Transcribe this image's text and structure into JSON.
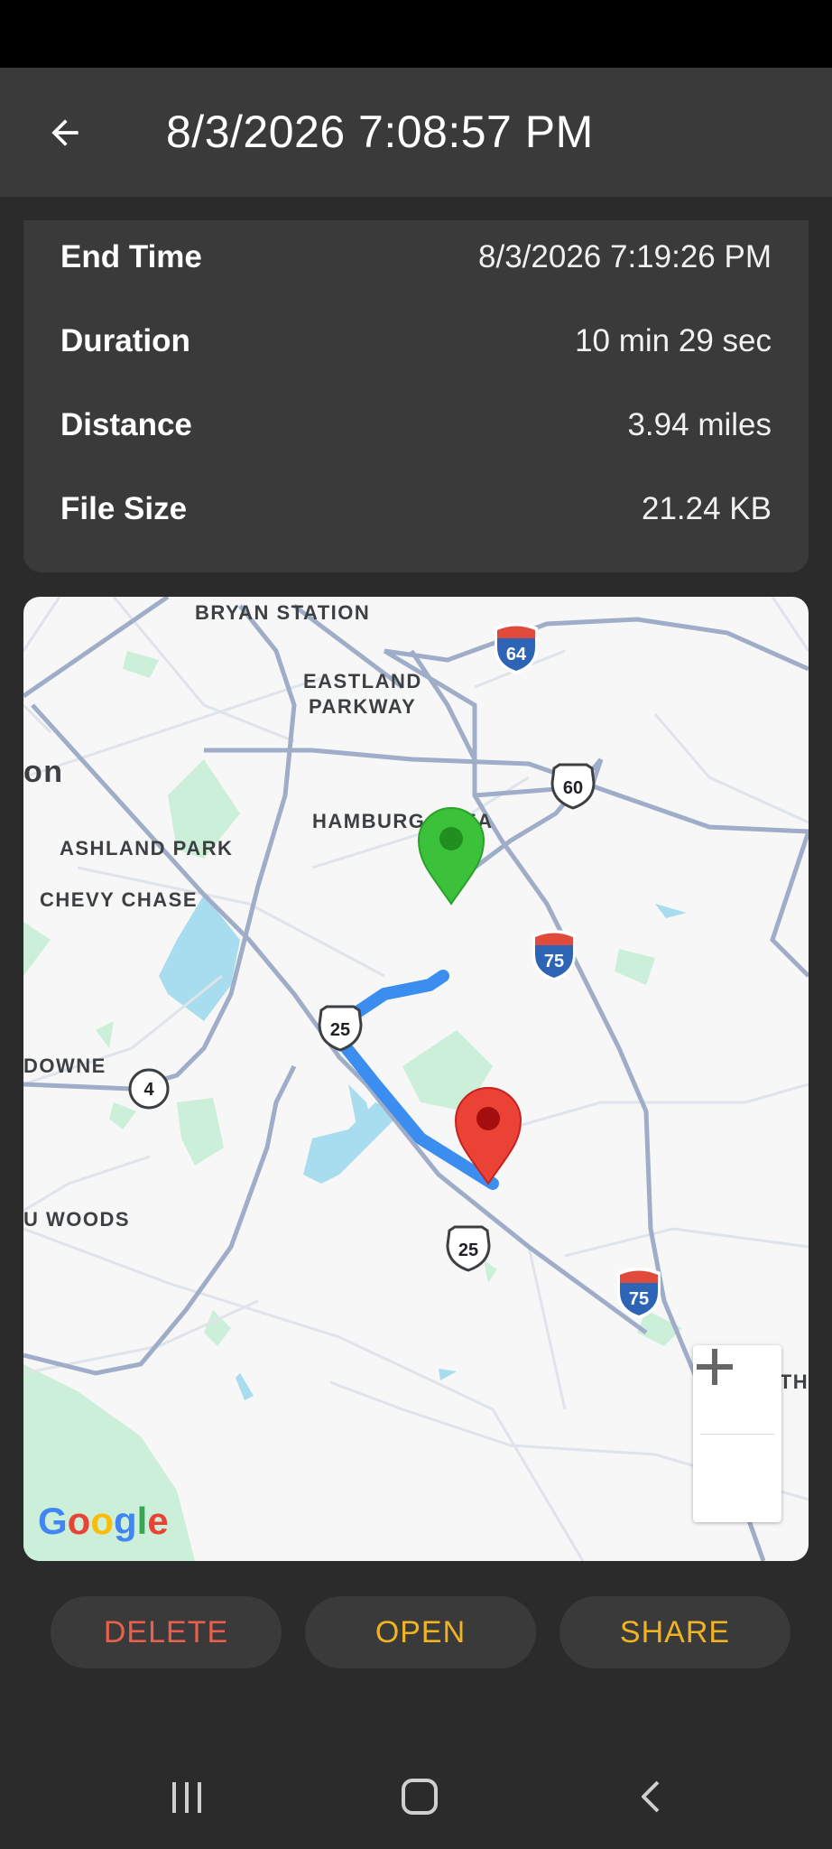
{
  "header": {
    "title": "8/3/2026 7:08:57 PM",
    "back_icon": "arrow-left-icon"
  },
  "details": [
    {
      "label": "End Time",
      "value": "8/3/2026 7:19:26 PM"
    },
    {
      "label": "Duration",
      "value": "10 min 29 sec"
    },
    {
      "label": "Distance",
      "value": "3.94 miles"
    },
    {
      "label": "File Size",
      "value": "21.24 KB"
    }
  ],
  "map": {
    "labels": {
      "bryan_station": "BRYAN STATION",
      "eastland_1": "EASTLAND",
      "eastland_2": "PARKWAY",
      "hamburg": "HAMBURG AREA",
      "ashland": "ASHLAND PARK",
      "chevy": "CHEVY CHASE",
      "downe": "DOWNE",
      "woods": "U WOODS",
      "athens": "ATHENS",
      "on": "on"
    },
    "shields": {
      "i64": "64",
      "i75a": "75",
      "i75b": "75",
      "us60": "60",
      "us25a": "25",
      "us25b": "25",
      "ky4": "4"
    },
    "start_marker_color": "#3cc13b",
    "end_marker_color": "#ea4335",
    "route_color": "#3b8ef0",
    "attribution": "Google",
    "zoom_in": "+",
    "zoom_out": "−"
  },
  "actions": {
    "delete": "DELETE",
    "open": "OPEN",
    "share": "SHARE",
    "delete_color": "#e8604c",
    "open_color": "#f0b323",
    "share_color": "#f0b323"
  },
  "nav": {
    "recents_icon": "recents-icon",
    "home_icon": "home-icon",
    "back_icon": "back-icon"
  }
}
